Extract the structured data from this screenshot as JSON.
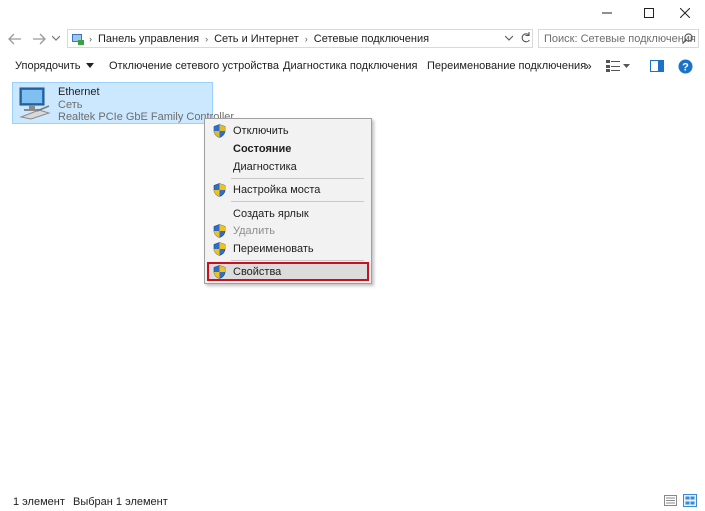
{
  "addressbar": {
    "crumbs": [
      "Панель управления",
      "Сеть и Интернет",
      "Сетевые подключения"
    ],
    "search_placeholder": "Поиск: Сетевые подключения"
  },
  "toolbar": {
    "organize": "Упорядочить",
    "disable_device": "Отключение сетевого устройства",
    "diagnose": "Диагностика подключения",
    "rename": "Переименование подключения",
    "more": "»"
  },
  "item": {
    "name": "Ethernet",
    "type": "Сеть",
    "device": "Realtek PCIe GbE Family Controller"
  },
  "context_menu": {
    "items": [
      {
        "label": "Отключить",
        "shield": true,
        "bold": false,
        "disabled": false
      },
      {
        "label": "Состояние",
        "shield": false,
        "bold": true,
        "disabled": false
      },
      {
        "label": "Диагностика",
        "shield": false,
        "bold": false,
        "disabled": false
      },
      {
        "label": "Настройка моста",
        "shield": true,
        "bold": false,
        "disabled": false
      },
      {
        "label": "Создать ярлык",
        "shield": false,
        "bold": false,
        "disabled": false
      },
      {
        "label": "Удалить",
        "shield": true,
        "bold": false,
        "disabled": true
      },
      {
        "label": "Переименовать",
        "shield": true,
        "bold": false,
        "disabled": false
      },
      {
        "label": "Свойства",
        "shield": true,
        "bold": false,
        "disabled": false,
        "highlighted": true
      }
    ]
  },
  "statusbar": {
    "count": "1 элемент",
    "selected": "Выбран 1 элемент"
  },
  "colors": {
    "selection": "#cce8ff",
    "highlight_border": "#c8101e",
    "help": "#1a73c8"
  },
  "icons": {
    "shield": "uac-shield-icon",
    "network": "network-adapter-icon"
  }
}
